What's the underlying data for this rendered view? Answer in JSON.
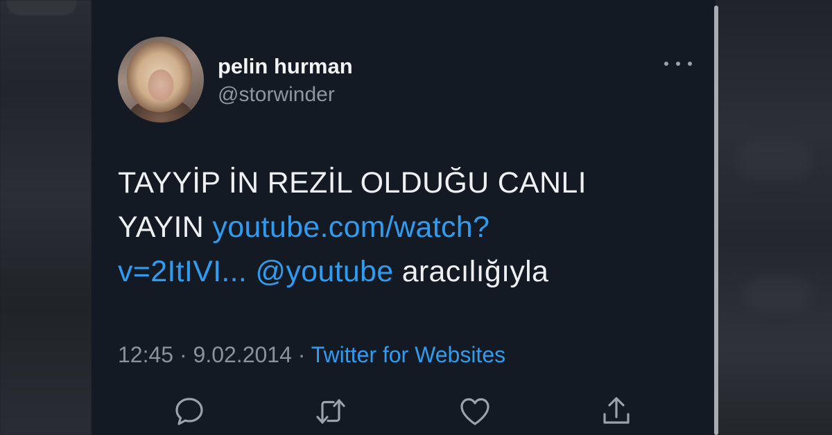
{
  "tweet": {
    "display_name": "pelin hurman",
    "handle": "@storwinder",
    "text_line1": "TAYYİP İN REZİL OLDUĞU CANLI",
    "text_line2_plain": "YAYIN ",
    "text_link_part1": "youtube.com/watch?",
    "text_link_part2": "v=2ItIVI...",
    "text_mention": "@youtube",
    "text_suffix": " aracılığıyla",
    "time": "12:45",
    "separator": "·",
    "date": "9.02.2014",
    "source": "Twitter for Websites"
  },
  "icons": {
    "more": "more-options-icon",
    "reply": "reply-icon",
    "retweet": "retweet-icon",
    "like": "heart-icon",
    "share": "share-icon"
  },
  "colors": {
    "background": "#141a24",
    "link": "#2e9cf0",
    "text": "#eef0f2",
    "muted": "#8a929b"
  }
}
